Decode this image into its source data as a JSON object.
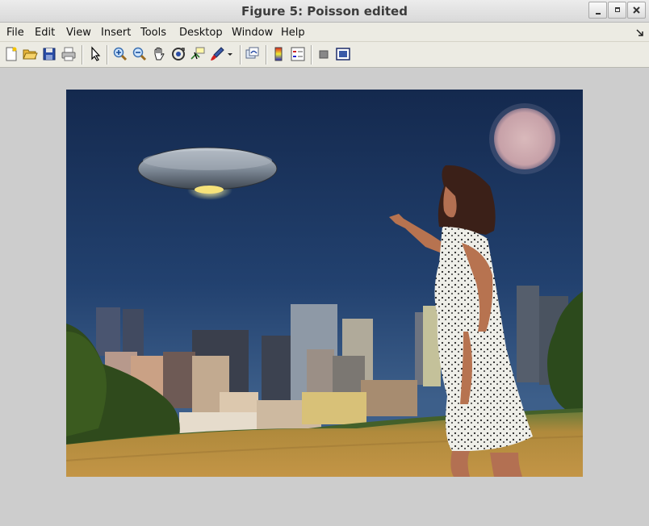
{
  "window": {
    "title": "Figure 5: Poisson edited"
  },
  "menu": {
    "items": [
      {
        "label": "File"
      },
      {
        "label": "Edit"
      },
      {
        "label": "View"
      },
      {
        "label": "Insert"
      },
      {
        "label": "Tools"
      },
      {
        "label": "Desktop"
      },
      {
        "label": "Window"
      },
      {
        "label": "Help"
      }
    ]
  },
  "toolbar": {
    "icons": [
      "new-figure-icon",
      "open-file-icon",
      "save-icon",
      "print-icon",
      "edit-plot-arrow-icon",
      "zoom-in-icon",
      "zoom-out-icon",
      "pan-hand-icon",
      "rotate-3d-icon",
      "data-cursor-icon",
      "brush-icon",
      "brush-dropdown-icon",
      "link-plot-icon",
      "insert-colorbar-icon",
      "insert-legend-icon",
      "hide-plot-tools-icon",
      "show-plot-tools-icon"
    ]
  },
  "colors": {
    "sky": "#1c3560",
    "grass": "#b8893a",
    "titlebar": "#e0e0e0",
    "figure_bg": "#cdcdcd"
  }
}
